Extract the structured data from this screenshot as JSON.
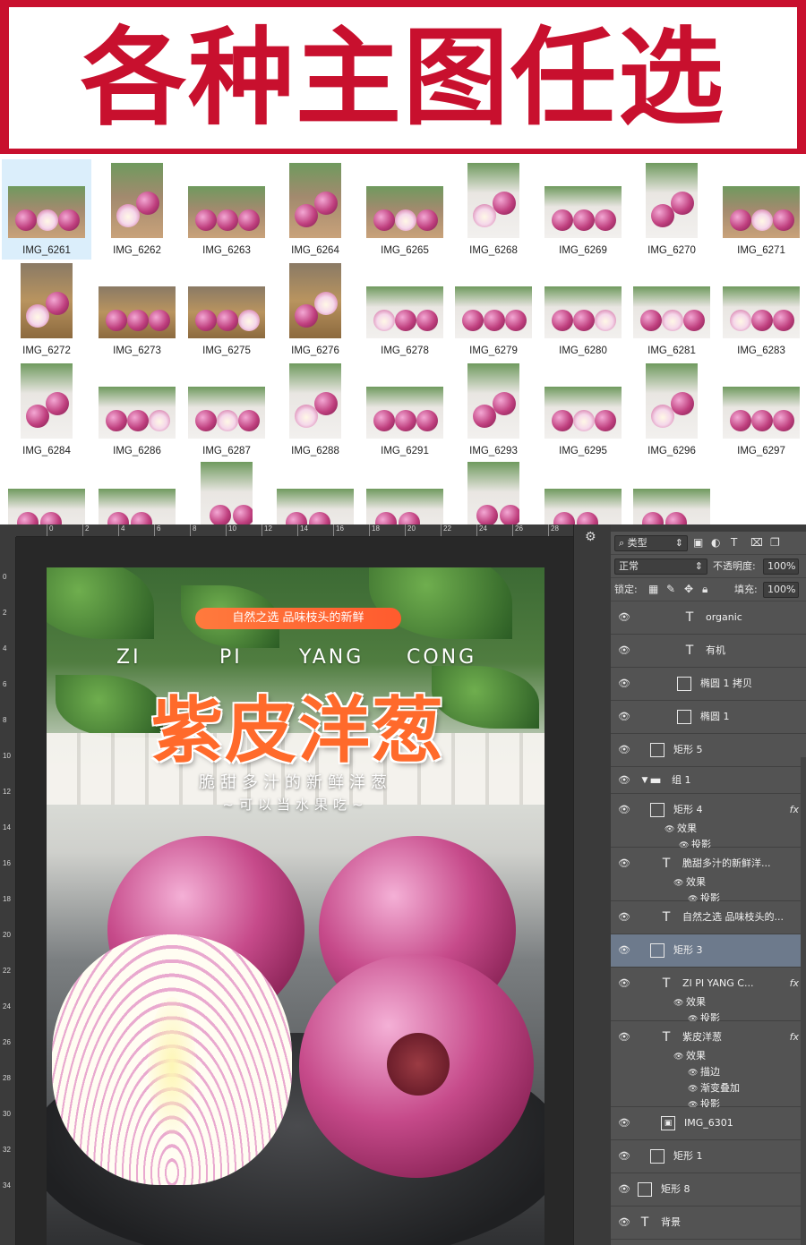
{
  "banner": {
    "title": "各种主图任选"
  },
  "thumbnails": [
    {
      "name": "IMG_6261",
      "selected": true
    },
    {
      "name": "IMG_6262"
    },
    {
      "name": "IMG_6263"
    },
    {
      "name": "IMG_6264"
    },
    {
      "name": "IMG_6265"
    },
    {
      "name": "IMG_6268"
    },
    {
      "name": "IMG_6269"
    },
    {
      "name": "IMG_6270"
    },
    {
      "name": "IMG_6271"
    },
    {
      "name": "IMG_6272"
    },
    {
      "name": "IMG_6273"
    },
    {
      "name": "IMG_6275"
    },
    {
      "name": "IMG_6276"
    },
    {
      "name": "IMG_6278"
    },
    {
      "name": "IMG_6279"
    },
    {
      "name": "IMG_6280"
    },
    {
      "name": "IMG_6281"
    },
    {
      "name": "IMG_6283"
    },
    {
      "name": "IMG_6284"
    },
    {
      "name": "IMG_6286"
    },
    {
      "name": "IMG_6287"
    },
    {
      "name": "IMG_6288"
    },
    {
      "name": "IMG_6291"
    },
    {
      "name": "IMG_6293"
    },
    {
      "name": "IMG_6295"
    },
    {
      "name": "IMG_6296"
    },
    {
      "name": "IMG_6297"
    }
  ],
  "ruler": {
    "top_ticks": [
      "0",
      "2",
      "4",
      "6",
      "8",
      "10",
      "12",
      "14",
      "16",
      "18",
      "20",
      "22",
      "24",
      "26",
      "28"
    ],
    "left_ticks": [
      "0",
      "2",
      "4",
      "6",
      "8",
      "10",
      "12",
      "14",
      "16",
      "18",
      "20",
      "22",
      "24",
      "26",
      "28",
      "30",
      "32",
      "34"
    ]
  },
  "poster": {
    "badge": "自然之选 品味枝头的新鲜",
    "pinyin": [
      "ZI",
      "PI",
      "YANG",
      "CONG"
    ],
    "title": "紫皮洋葱",
    "subtitle": "脆甜多汁的新鲜洋葱",
    "tagline": "~可以当水果吃~"
  },
  "layers_panel": {
    "filter_kind": "类型",
    "blend_mode": "正常",
    "opacity_label": "不透明度:",
    "opacity_value": "100%",
    "lock_label": "锁定:",
    "fill_label": "填充:",
    "fill_value": "100%",
    "layers": [
      {
        "kind": "text",
        "name": "organic"
      },
      {
        "kind": "text",
        "name": "有机"
      },
      {
        "kind": "shape",
        "name": "椭圆 1 拷贝"
      },
      {
        "kind": "shape",
        "name": "椭圆 1"
      },
      {
        "kind": "shape",
        "name": "矩形 5"
      },
      {
        "kind": "group",
        "name": "组 1"
      },
      {
        "kind": "shape",
        "name": "矩形 4",
        "fx": "fx",
        "effects_label": "效果",
        "effects": [
          "投影"
        ]
      },
      {
        "kind": "text",
        "name": "脆甜多汁的新鲜洋...",
        "effects_label": "效果",
        "effects": [
          "投影"
        ]
      },
      {
        "kind": "text",
        "name": "自然之选 品味枝头的..."
      },
      {
        "kind": "shape",
        "name": "矩形 3",
        "selected": true
      },
      {
        "kind": "text",
        "name": "ZI    PI    YANG  C...",
        "fx": "fx",
        "effects_label": "效果",
        "effects": [
          "投影"
        ]
      },
      {
        "kind": "text",
        "name": "紫皮洋葱",
        "fx": "fx",
        "effects_label": "效果",
        "effects": [
          "描边",
          "渐变叠加",
          "投影"
        ]
      },
      {
        "kind": "image",
        "name": "IMG_6301"
      },
      {
        "kind": "shape",
        "name": "矩形 1"
      },
      {
        "kind": "shape",
        "name": "矩形 8"
      },
      {
        "kind": "text",
        "name": "背景"
      }
    ]
  },
  "colors": {
    "banner_red": "#c8102e",
    "title_orange": "#ff6a2b",
    "selected_layer": "#6d7a8c"
  }
}
